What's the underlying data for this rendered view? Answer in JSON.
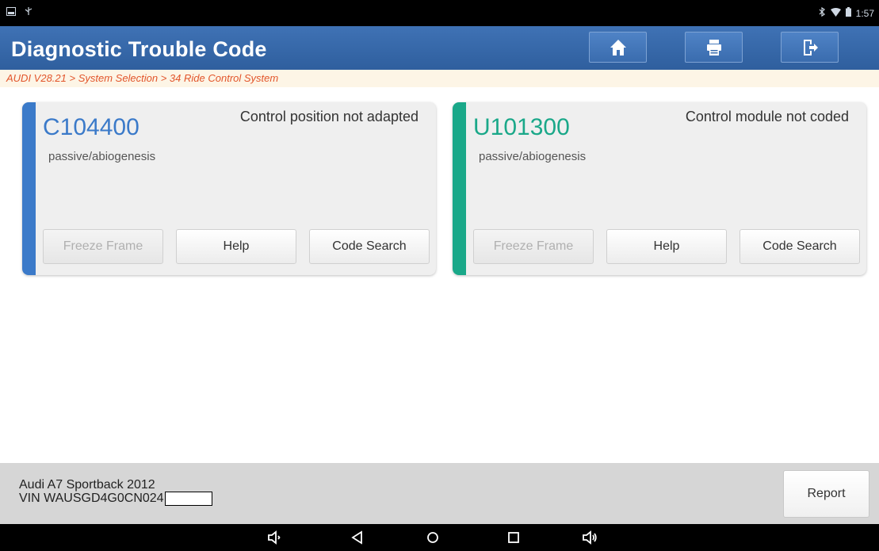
{
  "status_bar": {
    "left_icons": [
      "screenshot-icon",
      "usb-icon"
    ],
    "right_icons": [
      "bluetooth-icon",
      "wifi-icon",
      "battery-icon"
    ],
    "time": "1:57"
  },
  "header": {
    "title": "Diagnostic Trouble Code",
    "buttons": [
      "home-icon",
      "print-icon",
      "exit-icon"
    ]
  },
  "breadcrumb": "AUDI V28.21 > System Selection > 34 Ride Control System",
  "dtcs": [
    {
      "code": "C104400",
      "description": "Control position not adapted",
      "status": "passive/abiogenesis",
      "accent_color": "#3b7ac9",
      "buttons": {
        "freeze_frame": "Freeze Frame",
        "help": "Help",
        "code_search": "Code Search"
      }
    },
    {
      "code": "U101300",
      "description": "Control module not coded",
      "status": "passive/abiogenesis",
      "accent_color": "#1aa889",
      "buttons": {
        "freeze_frame": "Freeze Frame",
        "help": "Help",
        "code_search": "Code Search"
      }
    }
  ],
  "footer": {
    "vehicle": "Audi A7 Sportback 2012",
    "vin": "VIN WAUSGD4G0CN024",
    "report_label": "Report"
  },
  "navbar": {
    "icons": [
      "volume-down-icon",
      "back-icon",
      "home-circle-icon",
      "recents-icon",
      "volume-up-icon"
    ]
  }
}
